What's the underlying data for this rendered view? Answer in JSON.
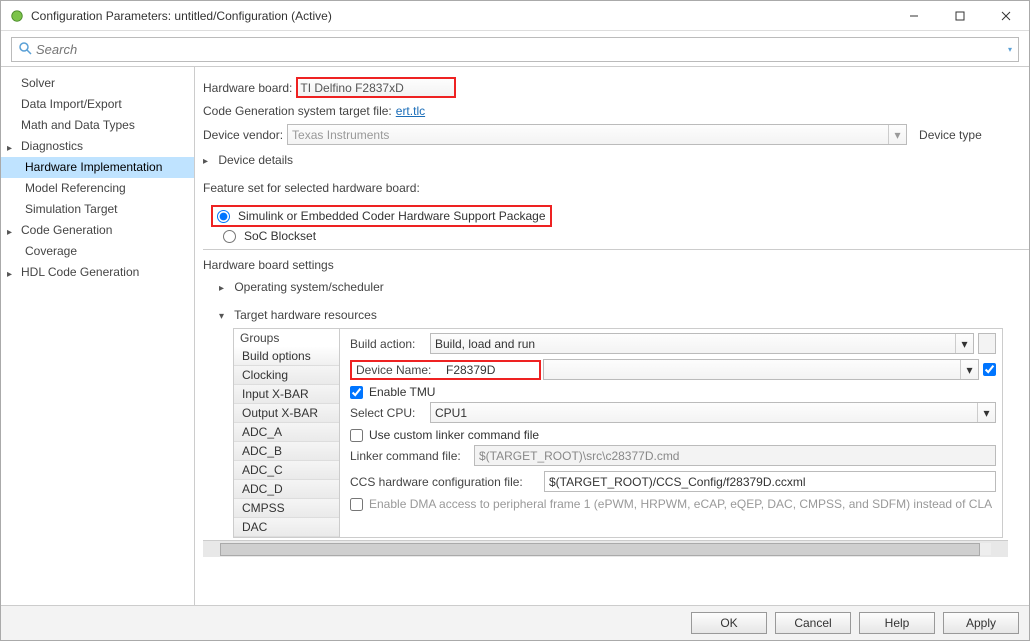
{
  "window": {
    "title": "Configuration Parameters: untitled/Configuration (Active)"
  },
  "search": {
    "placeholder": "Search"
  },
  "sidebar": {
    "items": [
      {
        "label": "Solver",
        "expandable": false,
        "level": 1
      },
      {
        "label": "Data Import/Export",
        "expandable": false,
        "level": 1
      },
      {
        "label": "Math and Data Types",
        "expandable": false,
        "level": 1
      },
      {
        "label": "Diagnostics",
        "expandable": true,
        "level": 0
      },
      {
        "label": "Hardware Implementation",
        "expandable": false,
        "level": 1,
        "selected": true
      },
      {
        "label": "Model Referencing",
        "expandable": false,
        "level": 1
      },
      {
        "label": "Simulation Target",
        "expandable": false,
        "level": 1
      },
      {
        "label": "Code Generation",
        "expandable": true,
        "level": 0
      },
      {
        "label": "Coverage",
        "expandable": false,
        "level": 1
      },
      {
        "label": "HDL Code Generation",
        "expandable": true,
        "level": 0
      }
    ]
  },
  "content": {
    "hardware_board_label": "Hardware board:",
    "hardware_board_value": "TI Delfino F2837xD",
    "codegen_target_label": "Code Generation system target file:",
    "codegen_target_link": "ert.tlc",
    "device_vendor_label": "Device vendor:",
    "device_vendor_value": "Texas Instruments",
    "device_type_label": "Device type",
    "device_details_label": "Device details",
    "feature_set_label": "Feature set for selected hardware board:",
    "feature_radio1": "Simulink or Embedded Coder Hardware Support Package",
    "feature_radio2": "SoC Blockset",
    "hw_settings_label": "Hardware board settings",
    "os_sched_label": "Operating system/scheduler",
    "target_res_label": "Target hardware resources",
    "groups_label": "Groups",
    "groups": [
      "Build options",
      "Clocking",
      "Input X-BAR",
      "Output X-BAR",
      "ADC_A",
      "ADC_B",
      "ADC_C",
      "ADC_D",
      "CMPSS",
      "DAC"
    ],
    "build_action_label": "Build action:",
    "build_action_value": "Build, load and run",
    "device_name_label": "Device Name:",
    "device_name_value": "F28379D",
    "enable_tmu_label": "Enable TMU",
    "select_cpu_label": "Select CPU:",
    "select_cpu_value": "CPU1",
    "use_custom_linker_label": "Use custom linker command file",
    "linker_cmd_label": "Linker command file:",
    "linker_cmd_value": "$(TARGET_ROOT)\\src\\c28377D.cmd",
    "ccs_config_label": "CCS hardware configuration file:",
    "ccs_config_value": "$(TARGET_ROOT)/CCS_Config/f28379D.ccxml",
    "enable_dma_label": "Enable DMA access to peripheral frame 1 (ePWM, HRPWM, eCAP, eQEP, DAC, CMPSS, and SDFM) instead of CLA"
  },
  "footer": {
    "ok": "OK",
    "cancel": "Cancel",
    "help": "Help",
    "apply": "Apply"
  }
}
